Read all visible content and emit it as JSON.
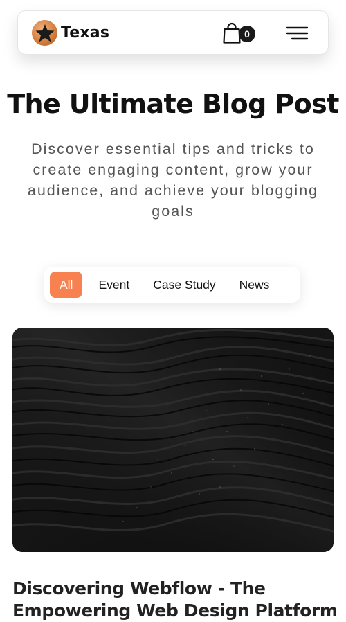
{
  "brand": {
    "name": "Texas",
    "logo_icon": "star-icon"
  },
  "cart": {
    "icon": "shopping-bag-icon",
    "count": "0"
  },
  "menu": {
    "icon": "hamburger-menu-icon"
  },
  "hero": {
    "title": "The Ultimate Blog Post",
    "subtitle": "Discover essential tips and tricks to create engaging content, grow your audience, and achieve your blogging goals"
  },
  "tabs": [
    {
      "label": "All",
      "active": true
    },
    {
      "label": "Event",
      "active": false
    },
    {
      "label": "Case Study",
      "active": false
    },
    {
      "label": "News",
      "active": false
    }
  ],
  "post": {
    "title": "Discovering Webflow - The Empowering Web Design Platform"
  },
  "colors": {
    "accent": "#f7814f",
    "text": "#111111",
    "muted": "#555555",
    "cart_badge": "#1a1a1a"
  }
}
